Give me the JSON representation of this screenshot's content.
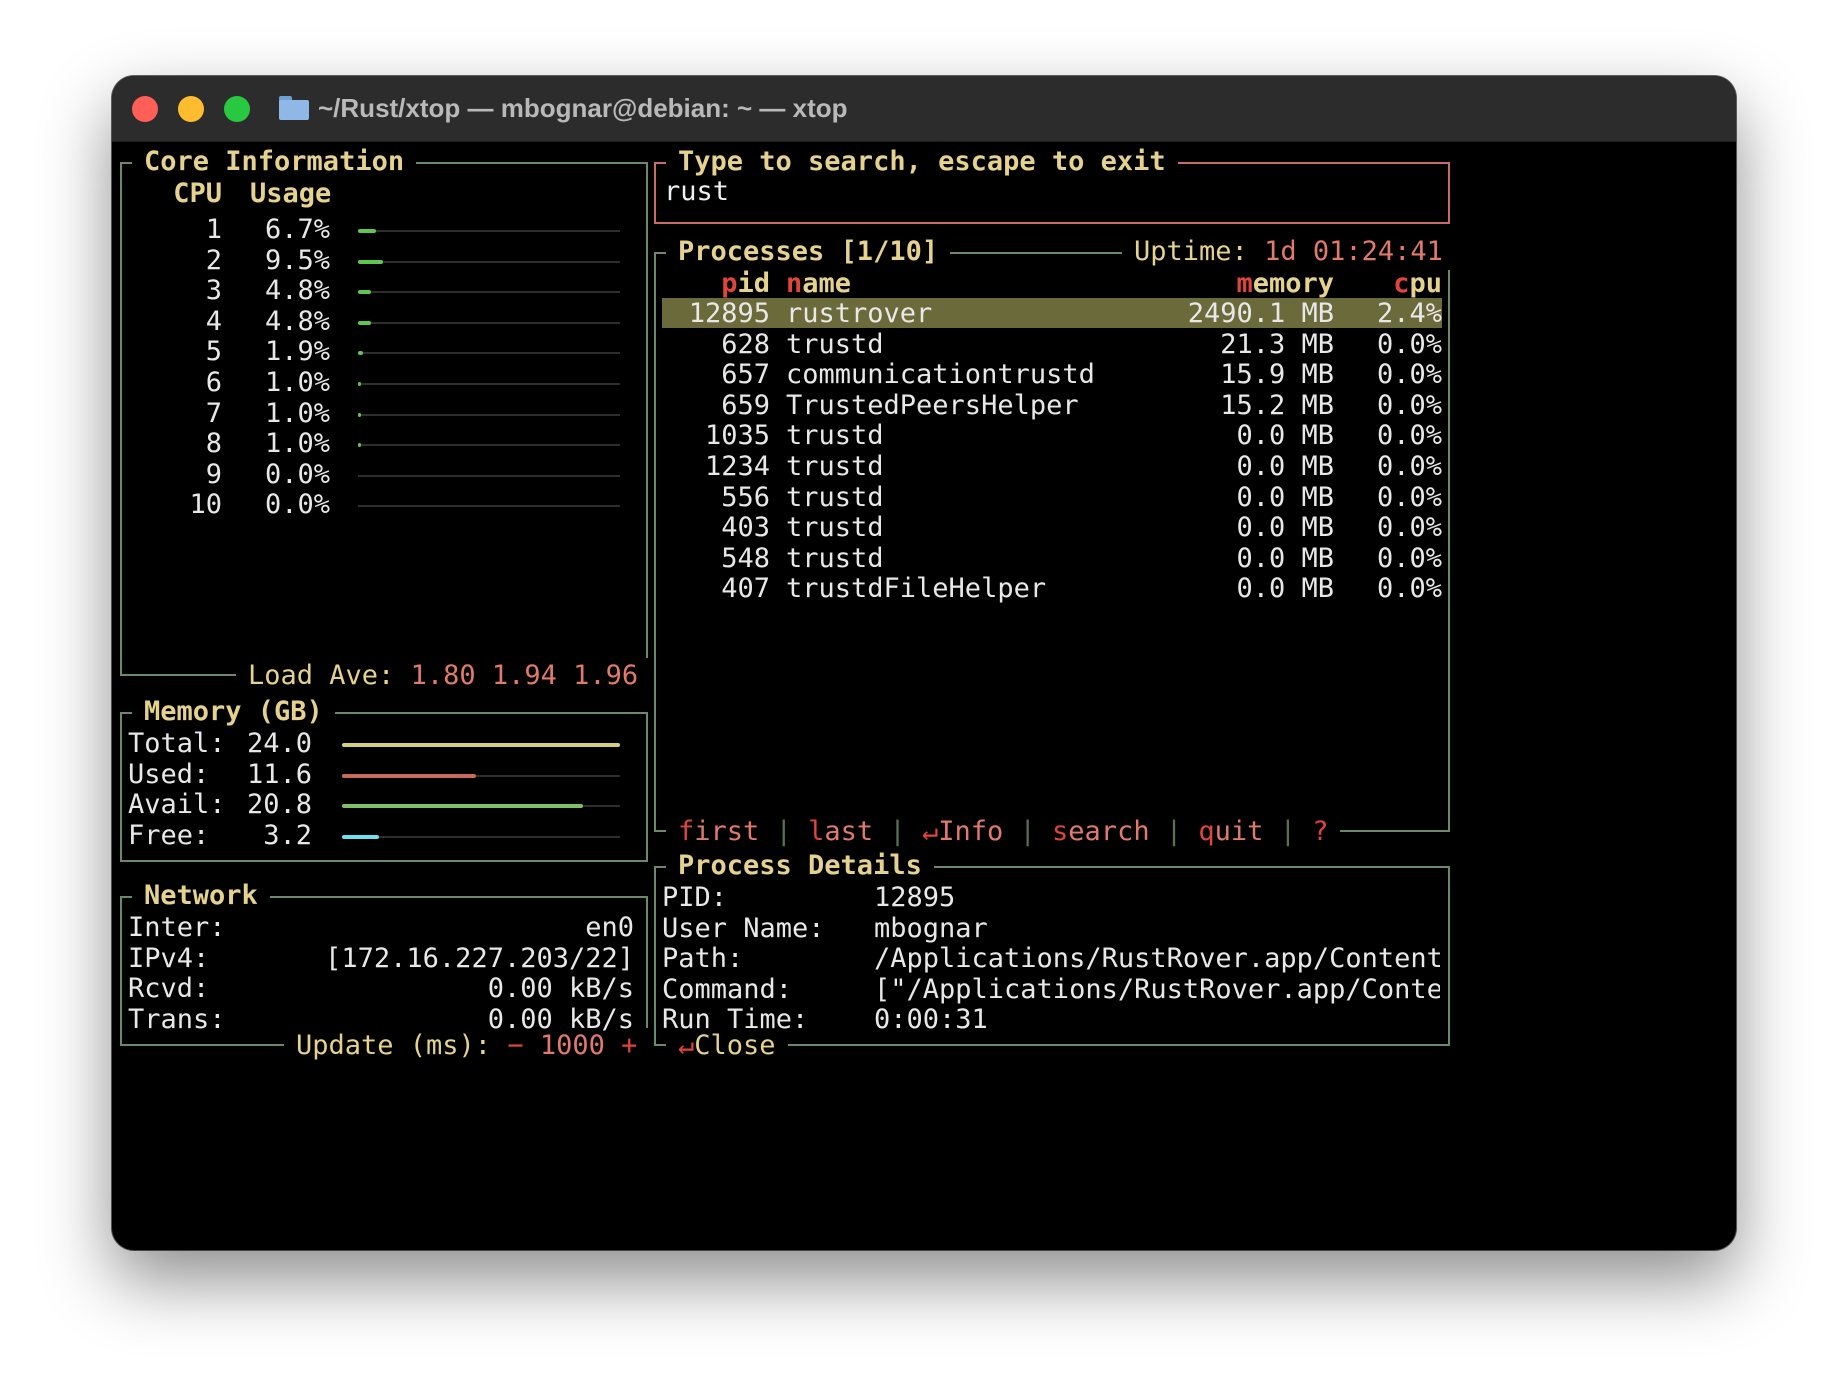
{
  "window": {
    "title": "~/Rust/xtop — mbognar@debian: ~ — xtop"
  },
  "core": {
    "title": "Core Information",
    "col_cpu": "CPU",
    "col_usage": "Usage",
    "rows": [
      {
        "cpu": "1",
        "usage": "6.7%",
        "value": 0.067
      },
      {
        "cpu": "2",
        "usage": "9.5%",
        "value": 0.095
      },
      {
        "cpu": "3",
        "usage": "4.8%",
        "value": 0.048
      },
      {
        "cpu": "4",
        "usage": "4.8%",
        "value": 0.048
      },
      {
        "cpu": "5",
        "usage": "1.9%",
        "value": 0.019
      },
      {
        "cpu": "6",
        "usage": "1.0%",
        "value": 0.01
      },
      {
        "cpu": "7",
        "usage": "1.0%",
        "value": 0.01
      },
      {
        "cpu": "8",
        "usage": "1.0%",
        "value": 0.01
      },
      {
        "cpu": "9",
        "usage": "0.0%",
        "value": 0.0
      },
      {
        "cpu": "10",
        "usage": "0.0%",
        "value": 0.0
      }
    ],
    "load_label": "Load Ave:",
    "load_values": "1.80 1.94 1.96"
  },
  "memory": {
    "title": "Memory (GB)",
    "rows": [
      {
        "label": "Total:",
        "value": "24.0",
        "fraction": 1.0,
        "color": "#d6d07a"
      },
      {
        "label": "Used:",
        "value": "11.6",
        "fraction": 0.483,
        "color": "#c86a5e"
      },
      {
        "label": "Avail:",
        "value": "20.8",
        "fraction": 0.867,
        "color": "#7fbf6a"
      },
      {
        "label": "Free:",
        "value": "3.2",
        "fraction": 0.133,
        "color": "#6ee0ee"
      }
    ]
  },
  "network": {
    "title": "Network",
    "rows": [
      {
        "label": "Inter:",
        "value": "en0"
      },
      {
        "label": "IPv4:",
        "value": "[172.16.227.203/22]"
      },
      {
        "label": "Rcvd:",
        "value": "0.00 kB/s"
      },
      {
        "label": "Trans:",
        "value": "0.00 kB/s"
      }
    ],
    "update_label": "Update (ms):",
    "update_minus": "−",
    "update_value": "1000",
    "update_plus": "+"
  },
  "search": {
    "title": "Type to search, escape to exit",
    "value": "rust"
  },
  "processes": {
    "title": "Processes [1/10]",
    "uptime_label": "Uptime:",
    "uptime_value": "1d 01:24:41",
    "headers": {
      "pid_hl": "p",
      "pid_rest": "id",
      "name_hl": "n",
      "name_rest": "ame",
      "mem_hl": "m",
      "mem_rest": "emory",
      "cpu_hl": "c",
      "cpu_rest": "pu"
    },
    "rows": [
      {
        "pid": "12895",
        "name": "rustrover",
        "memory": "2490.1 MB",
        "cpu": "2.4%"
      },
      {
        "pid": "628",
        "name": "trustd",
        "memory": "21.3 MB",
        "cpu": "0.0%"
      },
      {
        "pid": "657",
        "name": "communicationtrustd",
        "memory": "15.9 MB",
        "cpu": "0.0%"
      },
      {
        "pid": "659",
        "name": "TrustedPeersHelper",
        "memory": "15.2 MB",
        "cpu": "0.0%"
      },
      {
        "pid": "1035",
        "name": "trustd",
        "memory": "0.0 MB",
        "cpu": "0.0%"
      },
      {
        "pid": "1234",
        "name": "trustd",
        "memory": "0.0 MB",
        "cpu": "0.0%"
      },
      {
        "pid": "556",
        "name": "trustd",
        "memory": "0.0 MB",
        "cpu": "0.0%"
      },
      {
        "pid": "403",
        "name": "trustd",
        "memory": "0.0 MB",
        "cpu": "0.0%"
      },
      {
        "pid": "548",
        "name": "trustd",
        "memory": "0.0 MB",
        "cpu": "0.0%"
      },
      {
        "pid": "407",
        "name": "trustdFileHelper",
        "memory": "0.0 MB",
        "cpu": "0.0%"
      }
    ],
    "footer": {
      "first_hl": "f",
      "first_rest": "irst",
      "last_hl": "l",
      "last_rest": "ast",
      "info_hl": "↵",
      "info_rest": "Info",
      "search_hl": "s",
      "search_rest": "earch",
      "quit_hl": "q",
      "quit_rest": "uit",
      "help_hl": "?",
      "separator": "|"
    }
  },
  "details": {
    "title": "Process Details",
    "rows": [
      {
        "label": "PID:",
        "value": "12895"
      },
      {
        "label": "User Name:",
        "value": "mbognar"
      },
      {
        "label": "Path:",
        "value": "/Applications/RustRover.app/Contents/"
      },
      {
        "label": "Command:",
        "value": "[\"/Applications/RustRover.app/Content"
      },
      {
        "label": "Run Time:",
        "value": "0:00:31"
      }
    ],
    "close_hl": "↵",
    "close_rest": "Close"
  },
  "colors": {
    "border": "#6b8a6b",
    "title": "#e5d28e",
    "hotkey": "#e0453c",
    "cpu_gauge": "#5fc64f",
    "highlight_row": "#6b6a3a"
  }
}
